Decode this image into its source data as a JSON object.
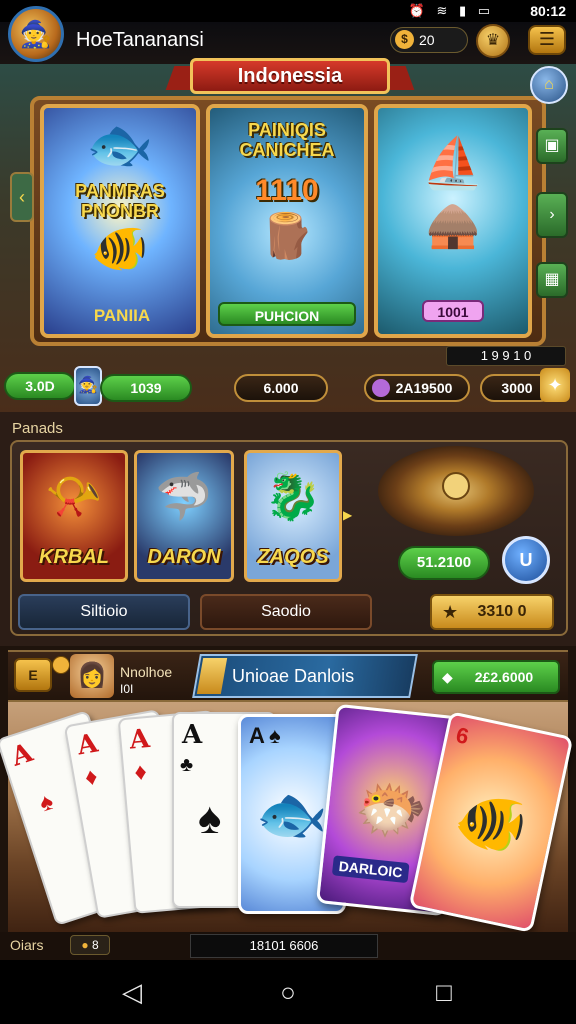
{
  "status_bar": {
    "time": "80:12",
    "icons": [
      "alarm-icon",
      "wifi-icon",
      "signal-icon",
      "battery-icon"
    ]
  },
  "app": {
    "title": "HoeTananansi",
    "coins": "20"
  },
  "banner": {
    "ribbon": "Indonessia",
    "cards": [
      {
        "title": "PANMRAS\nPNONBR",
        "label": "PANIIA"
      },
      {
        "title": "PAINIQIS\nCANICHEA",
        "number": "1110",
        "label": "PUHCION"
      },
      {
        "title": "",
        "label": "1001"
      }
    ],
    "page_indicator": "1  9  9 1 0"
  },
  "currency_row": {
    "a": "3.0D",
    "b": "1039",
    "c": "6.000",
    "d": "2A19500",
    "e": "3000"
  },
  "section2": {
    "label": "Panads",
    "cards": [
      "KRBAL",
      "DARON",
      "ZAQOS"
    ],
    "green_value": "51.2100",
    "blue_button": "U",
    "tabs": [
      "Siltioio",
      "Saodio"
    ],
    "gold_button": "3310 0"
  },
  "section3": {
    "back": "E",
    "player_name": "Nnolhoe",
    "player_level": "I0I",
    "title": "Unioae Danlois",
    "value": "2£2.6000",
    "cards": [
      {
        "rank": "A",
        "suit": "♠",
        "color": "#d0191b"
      },
      {
        "rank": "A",
        "suit": "♦",
        "color": "#d0191b"
      },
      {
        "rank": "A",
        "suit": "♦",
        "color": "#d0191b"
      },
      {
        "rank": "A",
        "suit": "♣",
        "color": "#111111"
      }
    ],
    "fancy_cards": [
      {
        "rank": "A",
        "suit": "♠"
      },
      {
        "rank": "",
        "label": "DARLOIC"
      },
      {
        "rank": "6"
      }
    ]
  },
  "bottom": {
    "label": "Oiars",
    "icon_value": "8",
    "display": "18101 6606"
  },
  "nav": {
    "icons": [
      "back-icon",
      "home-icon",
      "recents-icon"
    ]
  },
  "colors": {
    "gold": "#f2c35a",
    "green": "#2a8a22",
    "accent_red": "#d63a2a"
  }
}
